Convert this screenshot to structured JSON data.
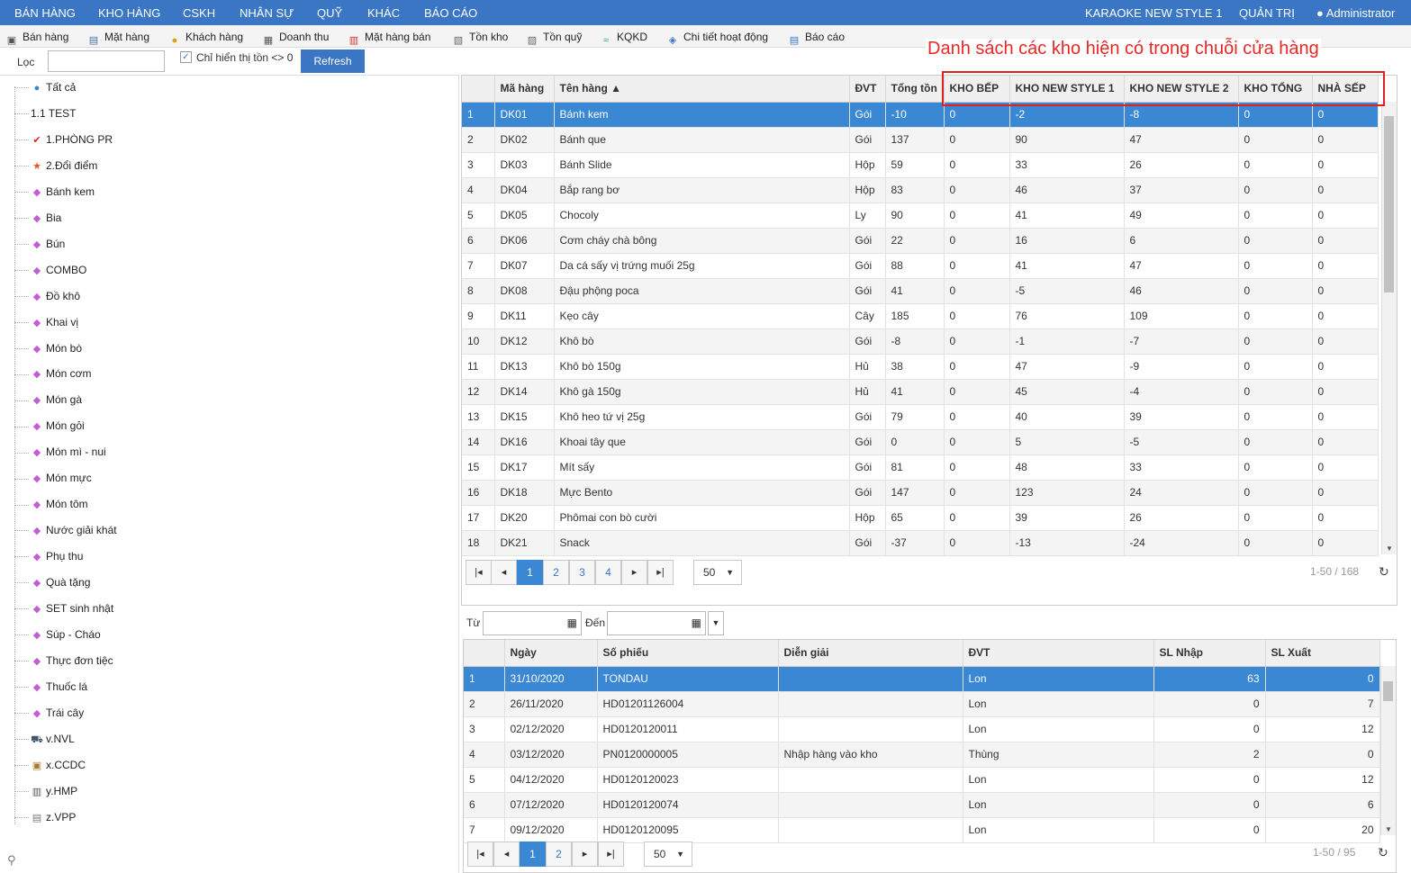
{
  "topbar": {
    "menu": [
      "BÁN HÀNG",
      "KHO HÀNG",
      "CSKH",
      "NHÂN SỰ",
      "QUỸ",
      "KHÁC",
      "BÁO CÁO"
    ],
    "store": "KARAOKE NEW STYLE 1",
    "admin_menu": "QUẢN TRỊ",
    "user": "Administrator"
  },
  "toolbar": [
    "Bán hàng",
    "Mặt hàng",
    "Khách hàng",
    "Doanh thu",
    "Mặt hàng bán",
    "Tồn kho",
    "Tồn quỹ",
    "KQKD",
    "Chi tiết hoạt động",
    "Báo cáo"
  ],
  "callout": "Danh sách các kho hiện có trong chuỗi cửa hàng",
  "filter": {
    "label": "Lọc",
    "checkbox": "Chỉ hiển thị tồn <> 0",
    "refresh": "Refresh"
  },
  "tree": [
    "Tất cả",
    "1.1 TEST",
    "1.PHÒNG PR",
    "2.Đổi điểm",
    "Bánh kem",
    "Bia",
    "Bún",
    "COMBO",
    "Đồ khô",
    "Khai vị",
    "Món bò",
    "Món cơm",
    "Món gà",
    "Món gỏi",
    "Món mì - nui",
    "Món mực",
    "Món tôm",
    "Nước giải khát",
    "Phụ thu",
    "Quà tặng",
    "SET sinh nhật",
    "Súp - Cháo",
    "Thực đơn tiệc",
    "Thuốc lá",
    "Trái cây",
    "v.NVL",
    "x.CCDC",
    "y.HMP",
    "z.VPP"
  ],
  "grid1": {
    "headers": [
      "",
      "Mã hàng",
      "Tên hàng ▲",
      "ĐVT",
      "Tổng tồn",
      "KHO BẾP",
      "KHO NEW STYLE 1",
      "KHO NEW STYLE 2",
      "KHO TỔNG",
      "NHÀ SẾP"
    ],
    "rows": [
      [
        "1",
        "DK01",
        "Bánh kem",
        "Gói",
        "-10",
        "0",
        "-2",
        "-8",
        "0",
        "0"
      ],
      [
        "2",
        "DK02",
        "Bánh que",
        "Gói",
        "137",
        "0",
        "90",
        "47",
        "0",
        "0"
      ],
      [
        "3",
        "DK03",
        "Bánh Slide",
        "Hộp",
        "59",
        "0",
        "33",
        "26",
        "0",
        "0"
      ],
      [
        "4",
        "DK04",
        "Bắp rang bơ",
        "Hộp",
        "83",
        "0",
        "46",
        "37",
        "0",
        "0"
      ],
      [
        "5",
        "DK05",
        "Chocoly",
        "Ly",
        "90",
        "0",
        "41",
        "49",
        "0",
        "0"
      ],
      [
        "6",
        "DK06",
        "Cơm cháy chà bông",
        "Gói",
        "22",
        "0",
        "16",
        "6",
        "0",
        "0"
      ],
      [
        "7",
        "DK07",
        "Da cá sấy vị trứng muối 25g",
        "Gói",
        "88",
        "0",
        "41",
        "47",
        "0",
        "0"
      ],
      [
        "8",
        "DK08",
        "Đậu phộng poca",
        "Gói",
        "41",
        "0",
        "-5",
        "46",
        "0",
        "0"
      ],
      [
        "9",
        "DK11",
        "Kẹo cây",
        "Cây",
        "185",
        "0",
        "76",
        "109",
        "0",
        "0"
      ],
      [
        "10",
        "DK12",
        "Khô bò",
        "Gói",
        "-8",
        "0",
        "-1",
        "-7",
        "0",
        "0"
      ],
      [
        "11",
        "DK13",
        "Khô bò 150g",
        "Hủ",
        "38",
        "0",
        "47",
        "-9",
        "0",
        "0"
      ],
      [
        "12",
        "DK14",
        "Khô gà 150g",
        "Hủ",
        "41",
        "0",
        "45",
        "-4",
        "0",
        "0"
      ],
      [
        "13",
        "DK15",
        "Khô heo tứ vị 25g",
        "Gói",
        "79",
        "0",
        "40",
        "39",
        "0",
        "0"
      ],
      [
        "14",
        "DK16",
        "Khoai tây que",
        "Gói",
        "0",
        "0",
        "5",
        "-5",
        "0",
        "0"
      ],
      [
        "15",
        "DK17",
        "Mít sấy",
        "Gói",
        "81",
        "0",
        "48",
        "33",
        "0",
        "0"
      ],
      [
        "16",
        "DK18",
        "Mực Bento",
        "Gói",
        "147",
        "0",
        "123",
        "24",
        "0",
        "0"
      ],
      [
        "17",
        "DK20",
        "Phômai con bò cười",
        "Hộp",
        "65",
        "0",
        "39",
        "26",
        "0",
        "0"
      ],
      [
        "18",
        "DK21",
        "Snack",
        "Gói",
        "-37",
        "0",
        "-13",
        "-24",
        "0",
        "0"
      ]
    ],
    "pages": [
      "1",
      "2",
      "3",
      "4"
    ],
    "page_size": "50",
    "info": "1-50 / 168"
  },
  "datefilter": {
    "from": "Từ",
    "to": "Đến"
  },
  "grid2": {
    "headers": [
      "",
      "Ngày",
      "Số phiếu",
      "Diễn giải",
      "ĐVT",
      "SL Nhập",
      "SL Xuất"
    ],
    "rows": [
      [
        "1",
        "31/10/2020",
        "TONDAU",
        "",
        "Lon",
        "63",
        "0"
      ],
      [
        "2",
        "26/11/2020",
        "HD01201126004",
        "",
        "Lon",
        "0",
        "7"
      ],
      [
        "3",
        "02/12/2020",
        "HD0120120011",
        "",
        "Lon",
        "0",
        "12"
      ],
      [
        "4",
        "03/12/2020",
        "PN0120000005",
        "Nhập hàng vào kho",
        "Thùng",
        "2",
        "0"
      ],
      [
        "5",
        "04/12/2020",
        "HD0120120023",
        "",
        "Lon",
        "0",
        "12"
      ],
      [
        "6",
        "07/12/2020",
        "HD0120120074",
        "",
        "Lon",
        "0",
        "6"
      ],
      [
        "7",
        "09/12/2020",
        "HD0120120095",
        "",
        "Lon",
        "0",
        "20"
      ]
    ],
    "pages": [
      "1",
      "2"
    ],
    "page_size": "50",
    "info": "1-50 / 95"
  }
}
